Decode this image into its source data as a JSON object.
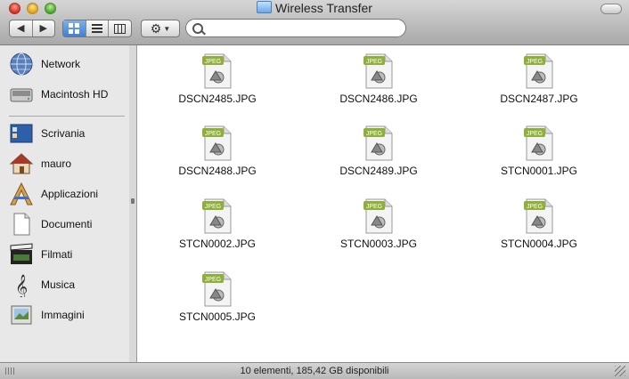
{
  "window": {
    "title": "Wireless Transfer"
  },
  "toolbar": {
    "back_icon": "back-arrow-icon",
    "forward_icon": "forward-arrow-icon",
    "views": [
      "icon-view-icon",
      "list-view-icon",
      "column-view-icon"
    ],
    "active_view": "icon-view",
    "action_icon": "gear-icon",
    "search_placeholder": ""
  },
  "sidebar": {
    "devices": [
      {
        "label": "Network",
        "icon": "network-globe-icon"
      },
      {
        "label": "Macintosh HD",
        "icon": "hard-disk-icon"
      }
    ],
    "places": [
      {
        "label": "Scrivania",
        "icon": "desktop-icon"
      },
      {
        "label": "mauro",
        "icon": "home-icon"
      },
      {
        "label": "Applicazioni",
        "icon": "applications-icon"
      },
      {
        "label": "Documenti",
        "icon": "documents-icon"
      },
      {
        "label": "Filmati",
        "icon": "movies-icon"
      },
      {
        "label": "Musica",
        "icon": "music-icon"
      },
      {
        "label": "Immagini",
        "icon": "pictures-icon"
      }
    ]
  },
  "files": [
    {
      "name": "DSCN2485.JPG"
    },
    {
      "name": "DSCN2486.JPG"
    },
    {
      "name": "DSCN2487.JPG"
    },
    {
      "name": "DSCN2488.JPG"
    },
    {
      "name": "DSCN2489.JPG"
    },
    {
      "name": "STCN0001.JPG"
    },
    {
      "name": "STCN0002.JPG"
    },
    {
      "name": "STCN0003.JPG"
    },
    {
      "name": "STCN0004.JPG"
    },
    {
      "name": "STCN0005.JPG"
    }
  ],
  "file_badge": "JPEG",
  "status": {
    "text": "10 elementi, 185,42 GB disponibili"
  },
  "colors": {
    "selected_view": "#3f7fd4",
    "jpeg_badge": "#8fae3a"
  }
}
